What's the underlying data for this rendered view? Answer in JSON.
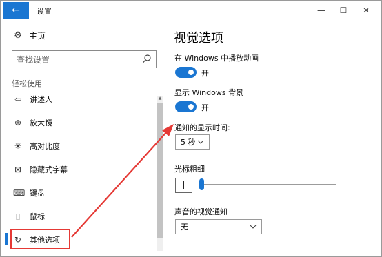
{
  "titlebar": {
    "back_icon": "←",
    "title": "设置",
    "minimize_glyph": "—",
    "maximize_glyph": "☐",
    "close_glyph": "✕"
  },
  "sidebar": {
    "home_label": "主页",
    "home_icon": "⚙",
    "search_placeholder": "查找设置",
    "section_label": "轻松使用",
    "items": [
      {
        "label": "讲述人",
        "icon": "⇦"
      },
      {
        "label": "放大镜",
        "icon": "⊕"
      },
      {
        "label": "高对比度",
        "icon": "☀"
      },
      {
        "label": "隐藏式字幕",
        "icon": "⊠"
      },
      {
        "label": "键盘",
        "icon": "⌨"
      },
      {
        "label": "鼠标",
        "icon": "▯"
      },
      {
        "label": "其他选项",
        "icon": "↻"
      }
    ],
    "active_item_index": 6
  },
  "main": {
    "title": "视觉选项",
    "animations": {
      "label": "在 Windows 中播放动画",
      "state": "开",
      "on": true
    },
    "background": {
      "label": "显示 Windows 背景",
      "state": "开",
      "on": true
    },
    "notification_duration": {
      "label": "通知的显示时间:",
      "value": "5 秒"
    },
    "cursor_thickness": {
      "label": "光标粗细",
      "value": 1
    },
    "visual_notification": {
      "label": "声音的视觉通知",
      "value": "无"
    }
  },
  "colors": {
    "accent": "#1a76d2",
    "annotation_red": "#e53935"
  }
}
